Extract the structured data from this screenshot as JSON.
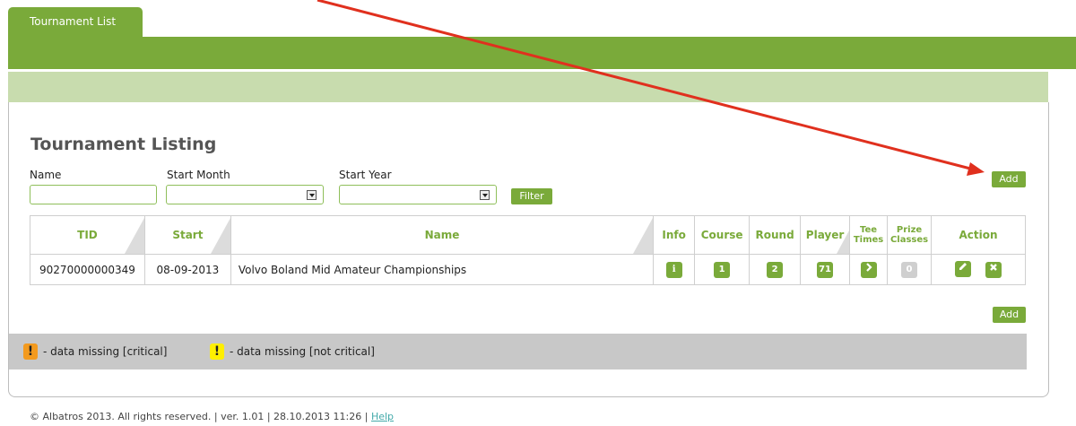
{
  "nav": {
    "tab_label": "Tournament List"
  },
  "page": {
    "title": "Tournament Listing"
  },
  "filters": {
    "name_label": "Name",
    "start_month_label": "Start Month",
    "start_year_label": "Start Year",
    "filter_button": "Filter",
    "name_value": "",
    "start_month_value": "",
    "start_year_value": ""
  },
  "actions": {
    "add_top": "Add",
    "add_bottom": "Add"
  },
  "table": {
    "headers": {
      "tid": "TID",
      "start": "Start",
      "name": "Name",
      "info": "Info",
      "course": "Course",
      "round": "Round",
      "player": "Player",
      "tee_times_1": "Tee",
      "tee_times_2": "Times",
      "prize_classes_1": "Prize",
      "prize_classes_2": "Classes",
      "action": "Action"
    },
    "rows": [
      {
        "tid": "90270000000349",
        "start": "08-09-2013",
        "name": "Volvo Boland Mid Amateur Championships",
        "info": "i",
        "course": "1",
        "round": "2",
        "player": "71",
        "prize_classes": "0"
      }
    ]
  },
  "legend": {
    "critical_symbol": "!",
    "critical_text": "- data missing [critical]",
    "noncritical_symbol": "!",
    "noncritical_text": "- data missing [not critical]",
    "critical_color": "#f39a1e",
    "noncritical_color": "#ffef00"
  },
  "footer": {
    "text": "© Albatros 2013. All rights reserved. | ver. 1.01 | 28.10.2013 11:26 |",
    "help_link": "Help"
  },
  "colors": {
    "accent": "#7aaa3a",
    "light_accent": "#c8dcae",
    "annotation_arrow": "#e0301e"
  },
  "icons": {
    "info": "info-icon",
    "tee_times": "chevron-right-icon",
    "edit": "pencil-icon",
    "delete": "close-icon",
    "select_dropdown": "chevron-down-icon"
  }
}
